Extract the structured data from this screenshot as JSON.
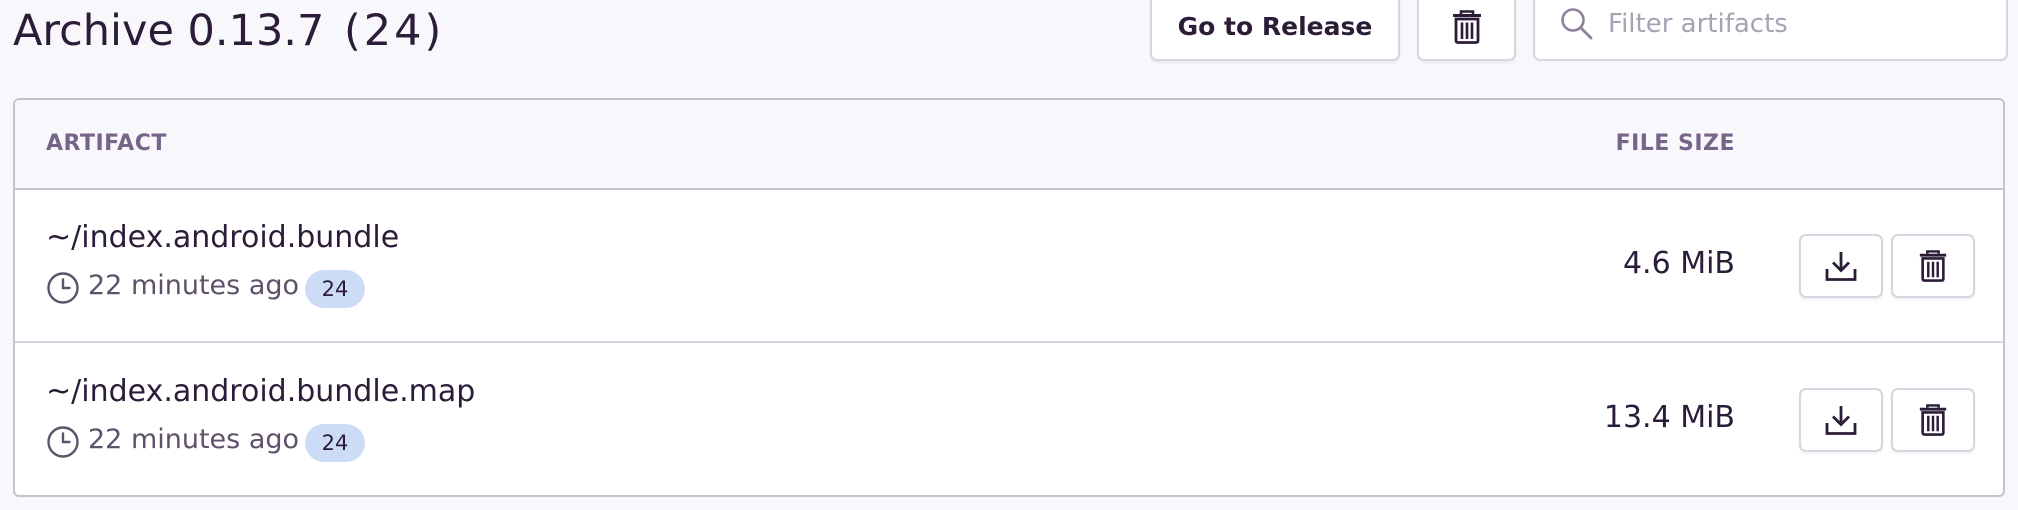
{
  "header": {
    "title": "Archive 0.13.7",
    "count": "(24)",
    "release_button_label": "Go to Release",
    "delete_all_icon": "trash-icon",
    "search": {
      "placeholder": "Filter artifacts",
      "value": "",
      "icon": "search-icon"
    }
  },
  "table": {
    "columns": {
      "artifact": "ARTIFACT",
      "file_size": "FILE SIZE"
    },
    "rows": [
      {
        "name": "~/index.android.bundle",
        "time": "22 minutes ago",
        "badge": "24",
        "size": "4.6 MiB",
        "icons": [
          "clock-icon",
          "download-icon",
          "trash-icon"
        ]
      },
      {
        "name": "~/index.android.bundle.map",
        "time": "22 minutes ago",
        "badge": "24",
        "size": "13.4 MiB",
        "icons": [
          "clock-icon",
          "download-icon",
          "trash-icon"
        ]
      }
    ]
  },
  "colors": {
    "text": "#2b1d38",
    "muted": "#776589",
    "border": "#c7c1d0",
    "badge": "#cddcf6",
    "page_bg": "#f8f7fb"
  }
}
